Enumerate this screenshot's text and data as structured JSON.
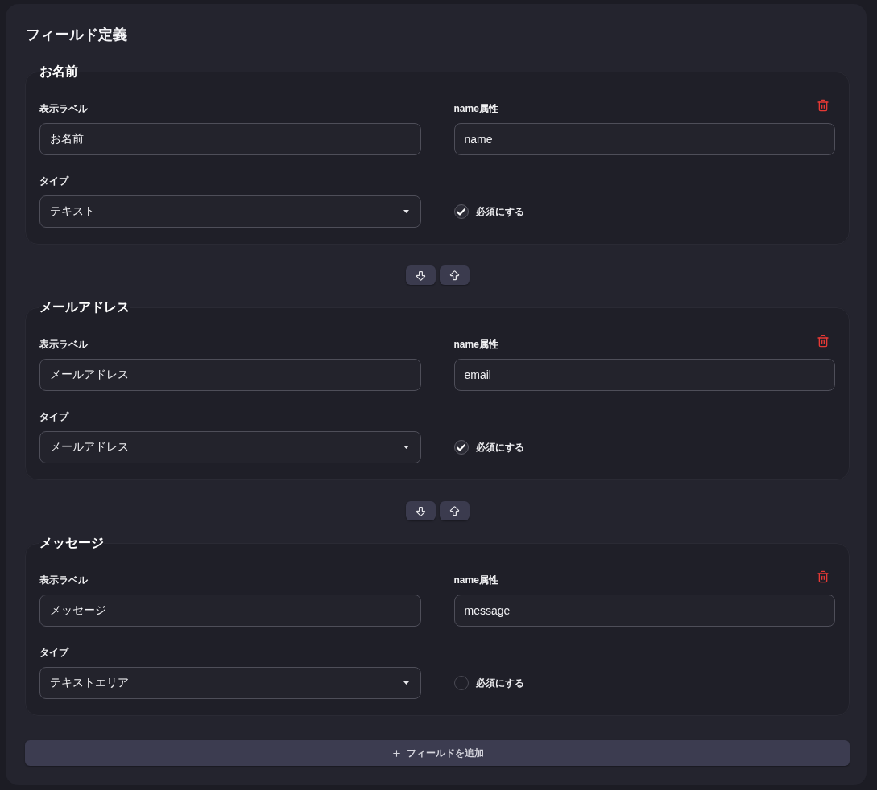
{
  "title": "フィールド定義",
  "fields": [
    {
      "heading": "お名前",
      "label_caption": "表示ラベル",
      "label_value": "お名前",
      "name_caption": "name属性",
      "name_value": "name",
      "type_caption": "タイプ",
      "type_value": "テキスト",
      "required_label": "必須にする",
      "required": true
    },
    {
      "heading": "メールアドレス",
      "label_caption": "表示ラベル",
      "label_value": "メールアドレス",
      "name_caption": "name属性",
      "name_value": "email",
      "type_caption": "タイプ",
      "type_value": "メールアドレス",
      "required_label": "必須にする",
      "required": true
    },
    {
      "heading": "メッセージ",
      "label_caption": "表示ラベル",
      "label_value": "メッセージ",
      "name_caption": "name属性",
      "name_value": "message",
      "type_caption": "タイプ",
      "type_value": "テキストエリア",
      "required_label": "必須にする",
      "required": false
    }
  ],
  "add_button": {
    "label": "フィールドを追加"
  }
}
